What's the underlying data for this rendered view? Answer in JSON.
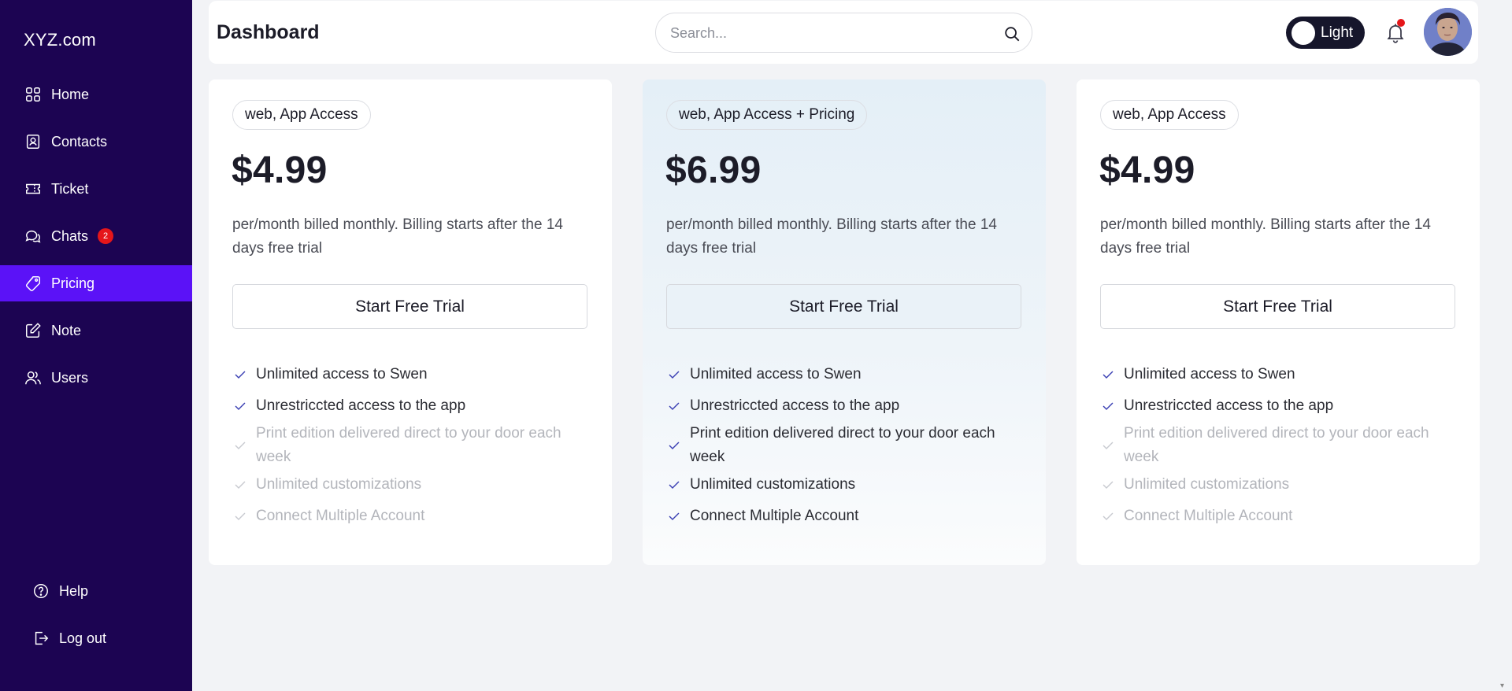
{
  "app": {
    "logo": "XYZ.com"
  },
  "sidebar": {
    "items": [
      {
        "label": "Home",
        "icon": "grid-icon"
      },
      {
        "label": "Contacts",
        "icon": "contact-card-icon"
      },
      {
        "label": "Ticket",
        "icon": "ticket-icon"
      },
      {
        "label": "Chats",
        "icon": "chat-bubbles-icon",
        "badge": "2"
      },
      {
        "label": "Pricing",
        "icon": "price-tag-icon",
        "active": true
      },
      {
        "label": "Note",
        "icon": "note-edit-icon"
      },
      {
        "label": "Users",
        "icon": "users-icon"
      }
    ],
    "bottom": [
      {
        "label": "Help",
        "icon": "help-circle-icon"
      },
      {
        "label": "Log out",
        "icon": "logout-icon"
      }
    ]
  },
  "header": {
    "title": "Dashboard",
    "search_placeholder": "Search...",
    "theme_toggle_label": "Light"
  },
  "colors": {
    "sidebar_bg": "#1c0452",
    "active_nav": "#5b12f7",
    "badge": "#e5161a",
    "check": "#3a3fb3"
  },
  "plans": [
    {
      "tag": "web, App Access",
      "price": "$4.99",
      "description": "per/month billed monthly. Billing starts after the 14 days free trial",
      "cta": "Start Free Trial",
      "features": [
        {
          "text": "Unlimited access to Swen",
          "included": true
        },
        {
          "text": "Unrestriccted access to the app",
          "included": true
        },
        {
          "text": "Print edition delivered direct to your door each week",
          "included": false
        },
        {
          "text": "Unlimited customizations",
          "included": false
        },
        {
          "text": "Connect Multiple Account",
          "included": false
        }
      ]
    },
    {
      "tag": "web, App Access + Pricing",
      "price": "$6.99",
      "description": "per/month billed monthly. Billing starts after the 14 days free trial",
      "cta": "Start Free Trial",
      "featured": true,
      "features": [
        {
          "text": "Unlimited access to Swen",
          "included": true
        },
        {
          "text": "Unrestriccted access to the app",
          "included": true
        },
        {
          "text": "Print edition delivered direct to your door each week",
          "included": true
        },
        {
          "text": "Unlimited customizations",
          "included": true
        },
        {
          "text": "Connect Multiple Account",
          "included": true
        }
      ]
    },
    {
      "tag": "web, App Access",
      "price": "$4.99",
      "description": "per/month billed monthly. Billing starts after the 14 days free trial",
      "cta": "Start Free Trial",
      "features": [
        {
          "text": "Unlimited access to Swen",
          "included": true
        },
        {
          "text": "Unrestriccted access to the app",
          "included": true
        },
        {
          "text": "Print edition delivered direct to your door each week",
          "included": false
        },
        {
          "text": "Unlimited customizations",
          "included": false
        },
        {
          "text": "Connect Multiple Account",
          "included": false
        }
      ]
    }
  ]
}
